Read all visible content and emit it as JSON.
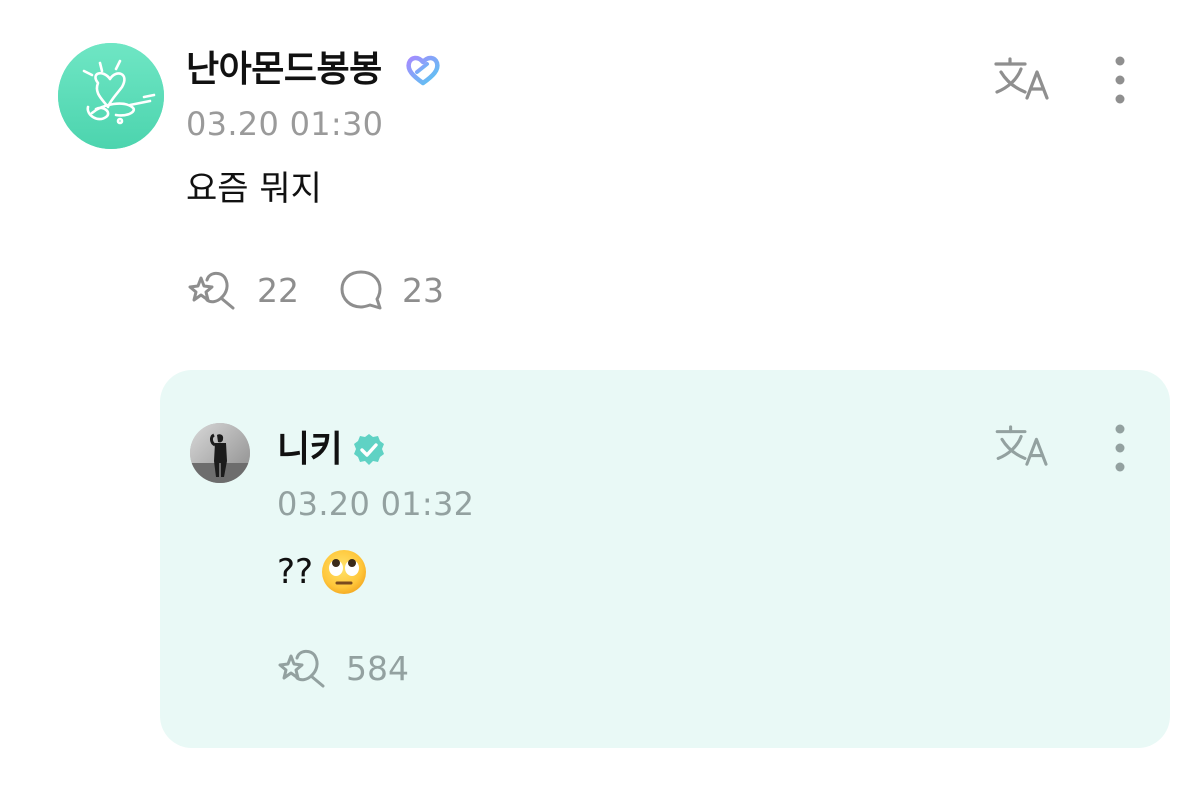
{
  "post": {
    "author_name": "난아몬드봉봉",
    "badge_icon": "membership-heart-badge-icon",
    "timestamp": "03.20 01:30",
    "text": "요즘 뭐지",
    "reaction_icon": "star-heart-reaction-icon",
    "reaction_count": "22",
    "comment_icon": "comment-bubble-icon",
    "comment_count": "23",
    "translate_icon": "translate-icon",
    "more_icon": "more-vertical-icon"
  },
  "reply": {
    "author_name": "니키",
    "badge_icon": "verified-check-icon",
    "timestamp": "03.20 01:32",
    "text": "??",
    "emoji": "face-with-rolling-eyes",
    "reaction_icon": "star-heart-reaction-icon",
    "reaction_count": "584",
    "translate_icon": "translate-icon",
    "more_icon": "more-vertical-icon"
  },
  "colors": {
    "reply_background": "#e9f9f6",
    "verified_badge": "#5fd2c4",
    "avatar_mint": "#59dcb6",
    "muted_text": "#9a9a9a"
  }
}
